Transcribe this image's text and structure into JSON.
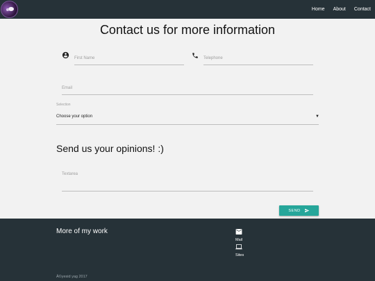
{
  "nav": {
    "links": [
      "Home",
      "About",
      "Contact"
    ]
  },
  "form": {
    "title": "Contact us for more information",
    "first_name_placeholder": "First Name",
    "telephone_placeholder": "Telephone",
    "email_placeholder": "Email",
    "selection_label": "Selection",
    "selection_value": "Choose your option",
    "opinions_title": "Send us your opinions! :)",
    "textarea_placeholder": "Textarea",
    "send_label": "SEND"
  },
  "footer": {
    "title": "More of my work",
    "mail_label": "Mail",
    "sites_label": "Sites",
    "copyright": "Â©yesid yag 2017"
  },
  "colors": {
    "navbar": "#263238",
    "accent": "#26a69a",
    "background": "#f2f2f2"
  },
  "icons": {
    "user": "account-circle-icon",
    "phone": "phone-icon",
    "send": "send-icon",
    "mail": "mail-icon",
    "sites": "laptop-icon"
  }
}
